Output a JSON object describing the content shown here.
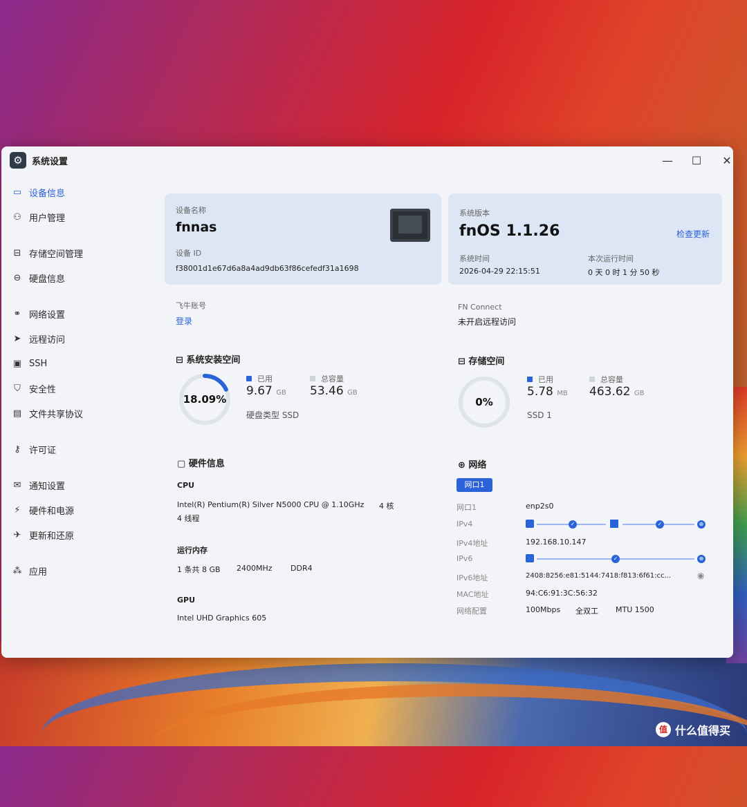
{
  "window": {
    "title": "系统设置",
    "controls": {
      "minimize": "—",
      "maximize": "☐",
      "close": "✕"
    }
  },
  "sidebar": {
    "items": [
      {
        "label": "设备信息",
        "icon": "monitor-icon",
        "active": true
      },
      {
        "label": "用户管理",
        "icon": "users-icon"
      },
      {
        "label": "存储空间管理",
        "icon": "storage-icon"
      },
      {
        "label": "硬盘信息",
        "icon": "disk-icon"
      },
      {
        "label": "网络设置",
        "icon": "network-icon"
      },
      {
        "label": "远程访问",
        "icon": "send-icon"
      },
      {
        "label": "SSH",
        "icon": "terminal-icon"
      },
      {
        "label": "安全性",
        "icon": "shield-icon"
      },
      {
        "label": "文件共享协议",
        "icon": "file-icon"
      },
      {
        "label": "许可证",
        "icon": "key-icon"
      },
      {
        "label": "通知设置",
        "icon": "mail-icon"
      },
      {
        "label": "硬件和电源",
        "icon": "power-icon"
      },
      {
        "label": "更新和还原",
        "icon": "rocket-icon"
      },
      {
        "label": "应用",
        "icon": "apps-icon"
      }
    ]
  },
  "device": {
    "name_label": "设备名称",
    "name": "fnnas",
    "id_label": "设备 ID",
    "id": "f38001d1e67d6a8a4ad9db63f86cefedf31a1698"
  },
  "system": {
    "version_label": "系统版本",
    "version": "fnOS  1.1.26",
    "check_update": "检查更新",
    "time_label": "系统时间",
    "time": "2026-04-29 22:15:51",
    "uptime_label": "本次运行时间",
    "uptime": "0 天 0 时 1 分 50 秒"
  },
  "account": {
    "label": "飞牛账号",
    "login": "登录"
  },
  "fn_connect": {
    "label": "FN Connect",
    "status": "未开启远程访问"
  },
  "sys_space": {
    "title": "系统安装空间",
    "percent_text": "18.09%",
    "percent": 18.09,
    "used_label": "已用",
    "used": "9.67",
    "used_unit": "GB",
    "total_label": "总容量",
    "total": "53.46",
    "total_unit": "GB",
    "disk_type": "硬盘类型 SSD"
  },
  "storage": {
    "title": "存储空间",
    "percent_text": "0%",
    "percent": 0,
    "used_label": "已用",
    "used": "5.78",
    "used_unit": "MB",
    "total_label": "总容量",
    "total": "463.62",
    "total_unit": "GB",
    "ssd": "SSD 1"
  },
  "hardware": {
    "title": "硬件信息",
    "cpu_label": "CPU",
    "cpu_model": "Intel(R) Pentium(R) Silver N5000 CPU @ 1.10GHz",
    "cpu_cores": "4 核",
    "cpu_threads": "4 线程",
    "mem_label": "运行内存",
    "mem_count": "1 条共 8 GB",
    "mem_freq": "2400MHz",
    "mem_type": "DDR4",
    "gpu_label": "GPU",
    "gpu_model": "Intel UHD Graphics 605"
  },
  "network": {
    "title": "网络",
    "tab": "网口1",
    "rows": [
      {
        "label": "网口1",
        "value": "enp2s0"
      },
      {
        "label": "IPv4",
        "value": ""
      },
      {
        "label": "IPv4地址",
        "value": "192.168.10.147"
      },
      {
        "label": "IPv6",
        "value": ""
      },
      {
        "label": "IPv6地址",
        "value": "2408:8256:e81:5144:7418:f813:6f61:cc..."
      },
      {
        "label": "MAC地址",
        "value": "94:C6:91:3C:56:32"
      },
      {
        "label": "网络配置",
        "value": "100Mbps"
      }
    ],
    "duplex": "全双工",
    "mtu": "MTU 1500"
  },
  "colors": {
    "accent": "#2a62d8",
    "card": "#dde6f4",
    "window": "#f3f4f8"
  },
  "watermark": {
    "text": "什么值得买",
    "icon": "值"
  }
}
